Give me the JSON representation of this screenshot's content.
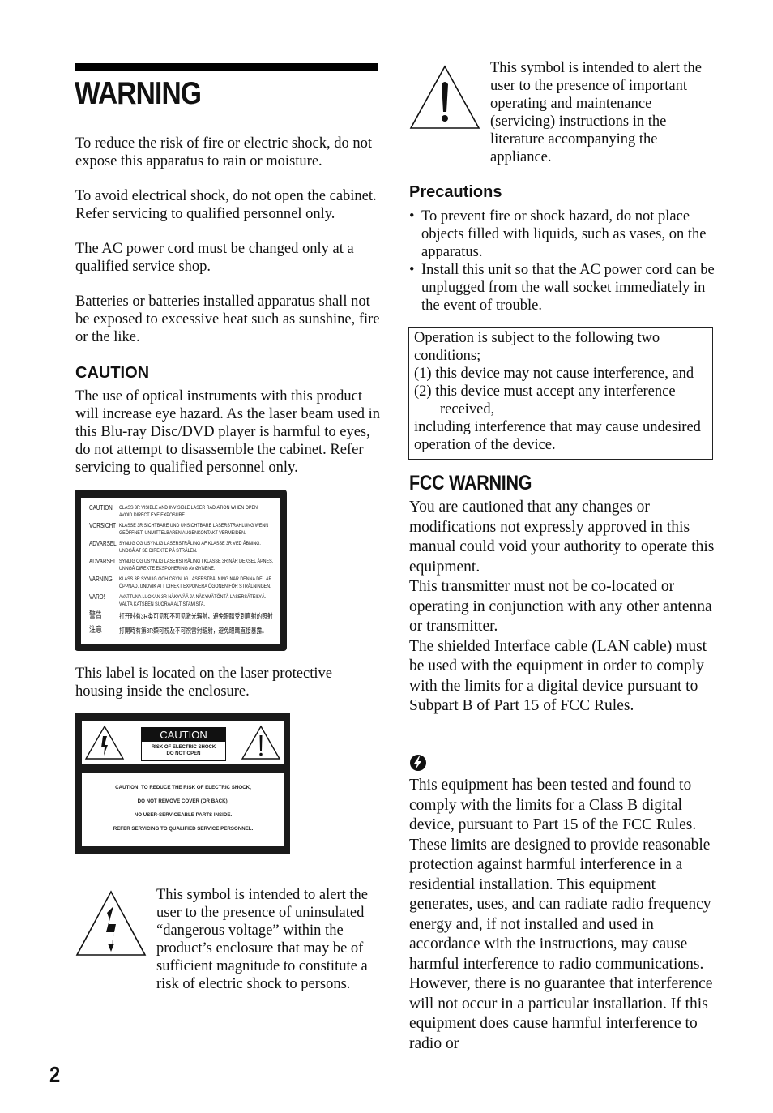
{
  "page": {
    "title": "WARNING",
    "page_number": "2"
  },
  "left_column": {
    "paragraphs": [
      "To reduce the risk of fire or electric shock, do not expose this apparatus to rain or moisture.",
      "To avoid electrical shock, do not open the cabinet. Refer servicing to qualified personnel only.",
      "The AC power cord must be changed only at a qualified service shop.",
      "Batteries or batteries installed apparatus shall not be exposed to excessive heat such as sunshine, fire or the like."
    ],
    "caution": {
      "heading": "CAUTION",
      "body": "The use of optical instruments with this product will increase eye hazard. As the laser beam used in this Blu-ray Disc/DVD player is harmful to eyes, do not attempt to disassemble the cabinet. Refer servicing to qualified personnel only."
    },
    "laser_label": {
      "rows": [
        {
          "lang": "CAUTION",
          "text": [
            "CLASS 3R VISIBLE AND INVISIBLE LASER RADIATION WHEN OPEN.",
            "AVOID DIRECT EYE EXPOSURE."
          ]
        },
        {
          "lang": "VORSICHT",
          "text": [
            "KLASSE 3R SICHTBARE UND UNSICHTBARE LASERSTRAHLUNG WENN",
            "GEÖFFNET. UNMITTELBAREN AUGENKONTAKT VERMEIDEN."
          ]
        },
        {
          "lang": "ADVARSEL",
          "text": [
            "SYNLIG OG USYNLIG LASERSTRÅLING AF KLASSE 3R VED ÅBNING.",
            "UNDGÅ AT SE DIREKTE PÅ STRÅLEN."
          ]
        },
        {
          "lang": "ADVARSEL",
          "text": [
            "SYNLIG OG USYNLIG LASERSTRÅLING I KLASSE 3R NÅR DEKSEL ÅPNES.",
            "UNNGÅ DIREKTE EKSPONERING AV ØYNENE."
          ]
        },
        {
          "lang": "VARNING",
          "text": [
            "KLASS 3R SYNLIG OCH OSYNLIG LASERSTRÅLNING NÄR DENNA DEL ÄR",
            "ÖPPNAD. UNDVIK ATT DIREKT EXPONERA ÖGONEN FÖR STRÅLNINGEN."
          ]
        },
        {
          "lang": "VARO!",
          "text": [
            "AVATTUNA LUOKAN 3R NÄKYVÄÄ JA NÄKYMÄTÖNTÄ LASERSÄTEILYÄ.",
            "VÄLTÄ KATSEEN SUORAA ALTISTAMISTA."
          ]
        },
        {
          "lang": "警告",
          "text": [
            "打开时有3R类可见和不可见激光辐射，避免眼睛受到直射的照射"
          ]
        },
        {
          "lang": "注意",
          "text": [
            "打開時有第3R類可視及不可視雷射輻射，避免眼睛直接暴露。"
          ]
        }
      ]
    },
    "label_note": "This label is located on the laser protective housing inside the enclosure.",
    "caution_panel": {
      "box_heading": "CAUTION",
      "box_lines": [
        "RISK OF ELECTRIC SHOCK",
        "DO NOT OPEN"
      ],
      "lines": [
        "CAUTION: TO REDUCE THE RISK OF ELECTRIC SHOCK,",
        "DO NOT REMOVE COVER (OR BACK).",
        "NO USER-SERVICEABLE PARTS INSIDE.",
        "REFER SERVICING TO QUALIFIED SERVICE PERSONNEL."
      ]
    },
    "shock_symbol_text": "This symbol is intended to alert the user to the presence of uninsulated “dangerous voltage” within the product’s enclosure that may be of sufficient magnitude to constitute a risk of electric shock to persons."
  },
  "right_column": {
    "alert_symbol_text": "This symbol is intended to alert the user to the presence of important operating and maintenance (servicing) instructions in the literature accompanying the appliance.",
    "precautions": {
      "heading": "Precautions",
      "items": [
        "To prevent fire or shock hazard, do not place objects filled with liquids, such as vases, on the apparatus.",
        "Install this unit so that the AC power cord can be unplugged from the wall socket immediately in the event of trouble."
      ]
    },
    "conditions_box": {
      "intro": "Operation is subject to the following two conditions;",
      "condition_1": "(1) this device may not cause interference, and",
      "condition_2": "(2) this device must accept any interference received,",
      "closing": "including interference that may cause undesired operation of the device."
    },
    "fcc_warning": {
      "heading": "FCC WARNING",
      "paragraphs": [
        "You are cautioned that any changes or modifications not expressly approved in this manual could void your authority to operate this equipment.",
        "This transmitter must not be co-located or operating in conjunction with any other antenna or transmitter.",
        "The shielded Interface cable (LAN cable) must be used with the equipment in order to comply with the limits for a digital device pursuant to Subpart B of Part 15 of FCC Rules."
      ]
    },
    "note": {
      "icon": "note-icon",
      "body": "This equipment has been tested and found to comply with the limits for a Class B digital device, pursuant to Part 15 of the FCC Rules. These limits are designed to provide reasonable protection against harmful interference in a residential installation. This equipment generates, uses, and can radiate radio frequency energy and, if not installed and used in accordance with the instructions, may cause harmful interference to radio communications. However, there is no guarantee that interference will not occur in a particular installation. If this equipment does cause harmful interference to radio or"
    }
  }
}
